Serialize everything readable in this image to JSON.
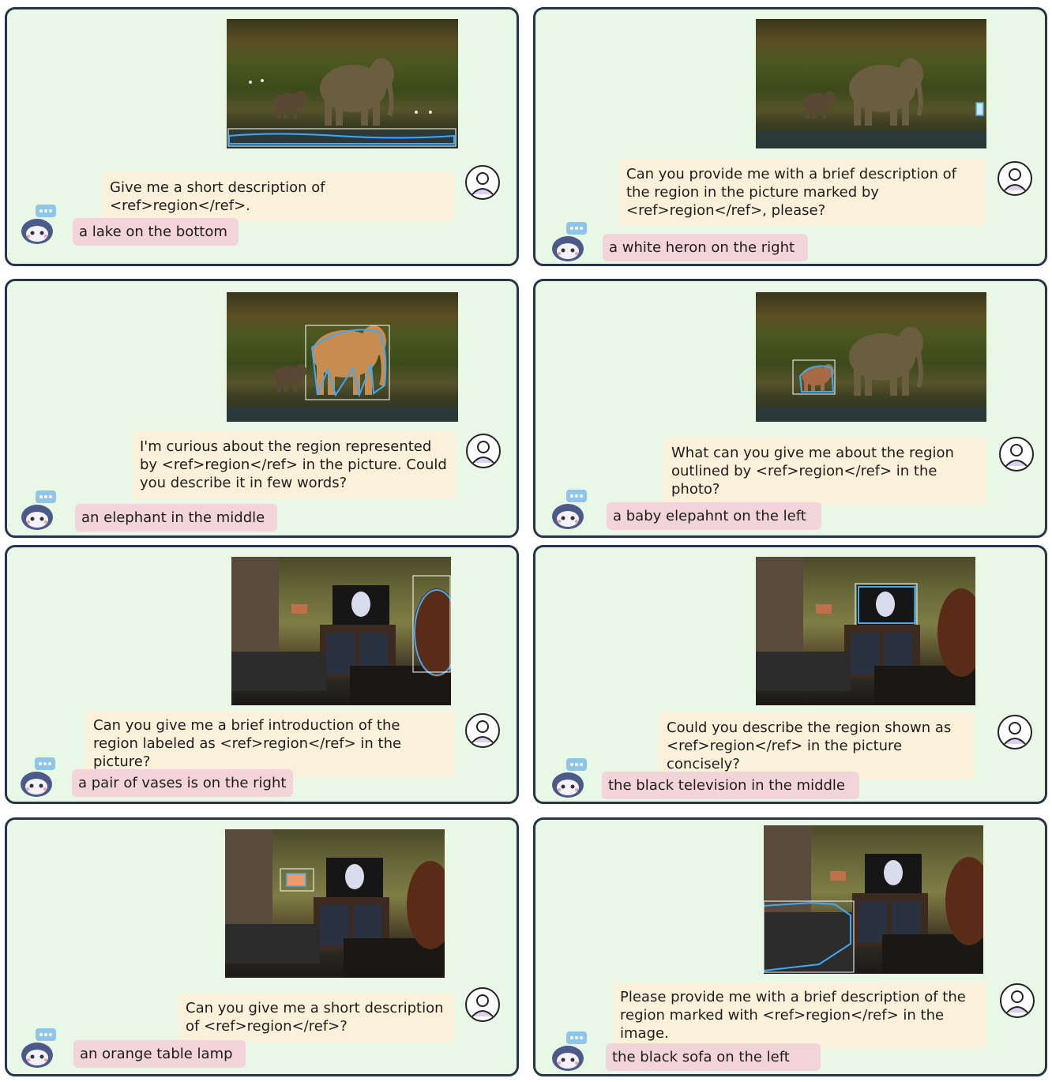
{
  "panels": [
    {
      "question": "Give me a short description of <ref>region</ref>.",
      "answer": "a lake on the bottom"
    },
    {
      "question": "Can you provide me with a brief description of the region in the picture marked by <ref>region</ref>, please?",
      "answer": "a white heron on the right"
    },
    {
      "question": "I'm curious about the region represented by <ref>region</ref> in the picture. Could you describe it in few words?",
      "answer": "an elephant in the middle"
    },
    {
      "question": "What can you give me about the region outlined by <ref>region</ref> in the photo?",
      "answer": "a baby elepahnt on the left"
    },
    {
      "question": "Can you give me a brief introduction of the region labeled as <ref>region</ref> in the picture?",
      "answer": "a pair of vases is on the right"
    },
    {
      "question": "Could you describe the region shown as <ref>region</ref> in the picture concisely?",
      "answer": "the black television in the middle"
    },
    {
      "question": "Can you give me a short description of <ref>region</ref>?",
      "answer": "an orange table lamp"
    },
    {
      "question": "Please provide me with a brief description of the region marked with <ref>region</ref> in the image.",
      "answer": "the black sofa on the left"
    }
  ],
  "icons": {
    "user": "user-avatar-icon",
    "bot": "robot-assistant-icon"
  },
  "colors": {
    "panel_bg": "#e9f8e6",
    "panel_border": "#27344a",
    "user_bubble": "#fbf1da",
    "bot_bubble": "#f3d4da",
    "highlight": "#3fa9f5"
  }
}
